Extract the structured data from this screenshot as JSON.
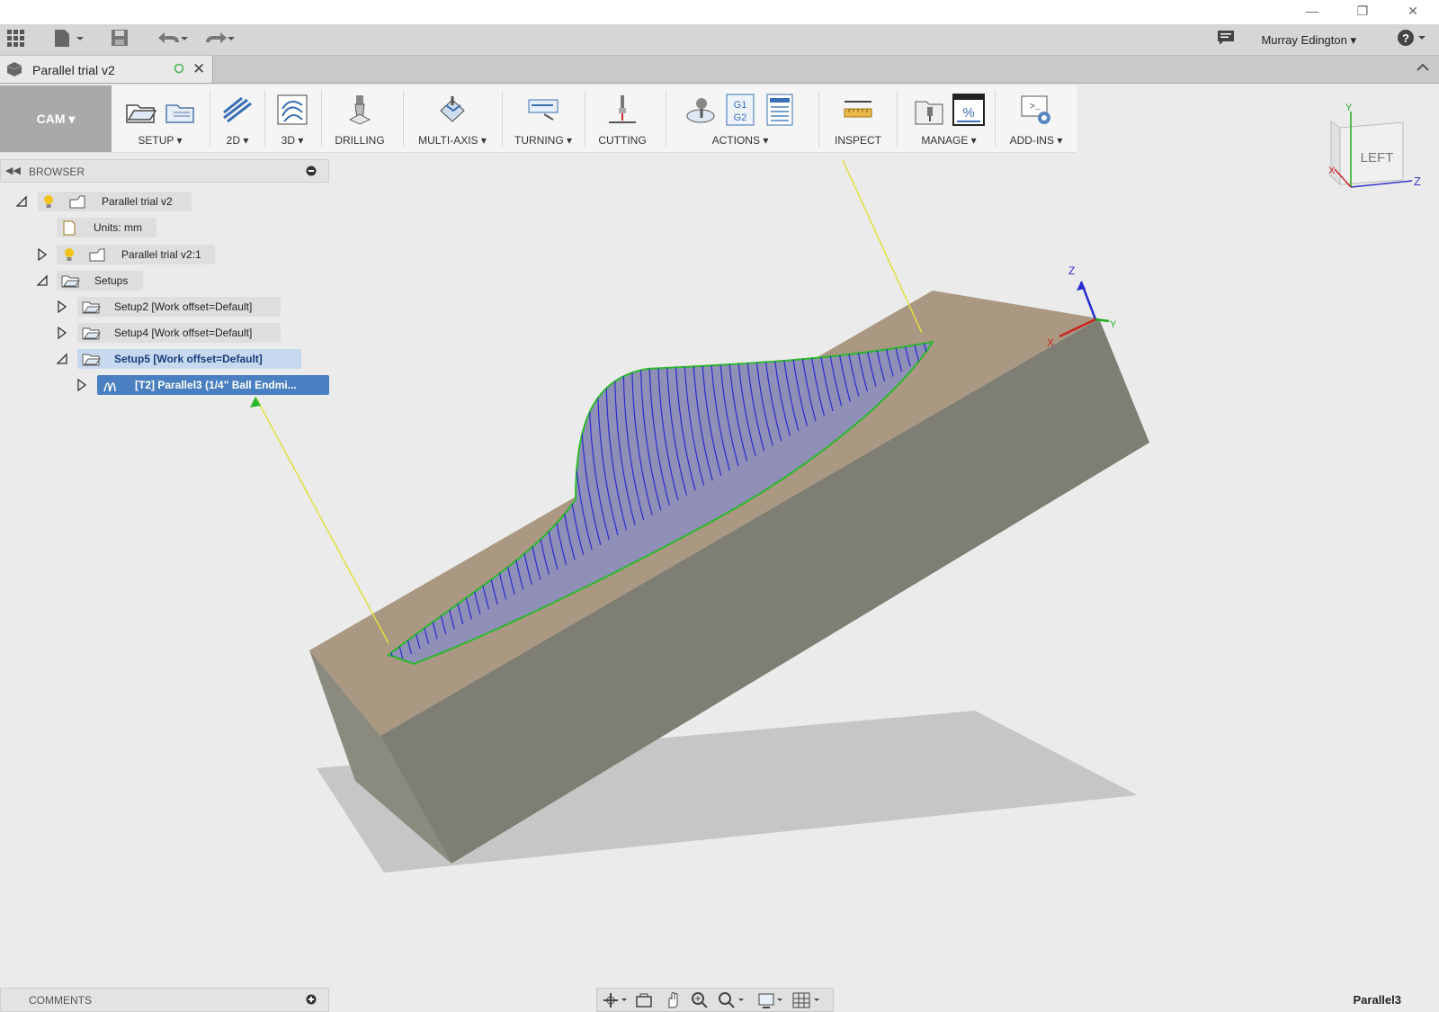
{
  "app": {
    "user": "Murray Edington"
  },
  "document_tab": {
    "title": "Parallel trial v2"
  },
  "workspace": {
    "label": "CAM"
  },
  "ribbon": {
    "groups": [
      "SETUP",
      "2D",
      "3D",
      "DRILLING",
      "MULTI-AXIS",
      "TURNING",
      "CUTTING",
      "ACTIONS",
      "INSPECT",
      "MANAGE",
      "ADD-INS"
    ]
  },
  "browser": {
    "title": "BROWSER",
    "tree": [
      {
        "label": "Parallel trial v2"
      },
      {
        "label": "Units: mm"
      },
      {
        "label": "Parallel trial v2:1"
      },
      {
        "label": "Setups"
      },
      {
        "label": "Setup2 [Work offset=Default]"
      },
      {
        "label": "Setup4 [Work offset=Default]"
      },
      {
        "label": "Setup5 [Work offset=Default]"
      },
      {
        "label": "[T2] Parallel3 (1/4\" Ball Endmi..."
      }
    ]
  },
  "comments": {
    "title": "COMMENTS"
  },
  "viewcube": {
    "face": "LEFT",
    "axes": [
      "Y",
      "X",
      "Z"
    ]
  },
  "triad": {
    "axes": [
      "Z",
      "X",
      "Y"
    ]
  },
  "status": {
    "operation": "Parallel3"
  },
  "colors": {
    "toolpath": "#2a2ad0",
    "boundary": "#2cb82c",
    "stock_top": "#a89880",
    "stock_side": "#7a7a72",
    "selection": "#4a7fc1"
  }
}
